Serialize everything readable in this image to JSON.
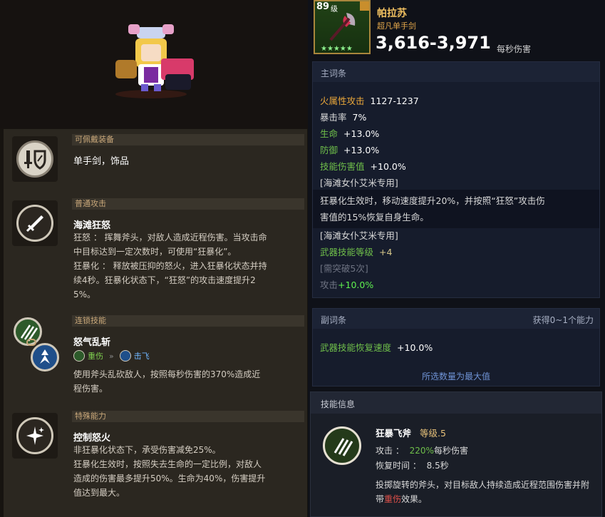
{
  "left": {
    "equip": {
      "category": "可佩戴装备",
      "name": "单手剑，饰品"
    },
    "normal_attack": {
      "category": "普通攻击",
      "name": "海滩狂怒",
      "lines": [
        "狂怒 ： 挥舞斧头，对敌人造成近程伤害。当攻击命",
        "中目标达到一定次数时，可使用“狂暴化”。",
        "狂暴化 ： 释放被压抑的怒火，进入狂暴化状态并持",
        "续4秒。狂暴化状态下，“狂怒”的攻击速度提升2",
        "5%。"
      ]
    },
    "chain": {
      "category": "连锁技能",
      "name": "怒气乱斩",
      "tag1": "重伤",
      "tag_arrows": "»",
      "tag2": "击飞",
      "lines": [
        "使用斧头乱砍敌人，按照每秒伤害的370%造成近",
        "程伤害。"
      ]
    },
    "special": {
      "category": "特殊能力",
      "name": "控制怒火",
      "lines": [
        "非狂暴化状态下，承受伤害减免25%。",
        "狂暴化生效时，按照失去生命的一定比例，对敌人",
        "造成的伤害最多提升50%。生命为40%，伤害提升",
        "值达到最大。"
      ]
    }
  },
  "weapon": {
    "level": "89",
    "level_unit": "级",
    "stars": "★★★★★",
    "name": "帕拉苏",
    "type": "超凡单手剑",
    "dps": "3,616-3,971",
    "dps_unit": "每秒伤害"
  },
  "main_stats": {
    "title": "主词条",
    "fire_label": "火属性攻击",
    "fire_value": "1127-1237",
    "crit_label": "暴击率",
    "crit_value": "7%",
    "hp_label": "生命",
    "hp_value": "+13.0%",
    "def_label": "防御",
    "def_value": "+13.0%",
    "skill_dmg_label": "技能伤害值",
    "skill_dmg_value": "+10.0%",
    "exclusive1": "[海滩女仆艾米专用]",
    "exclusive_desc_1": "狂暴化生效时，移动速度提升20%，并按照“狂怒”攻击伤",
    "exclusive_desc_2": "害值的15%恢复自身生命。",
    "exclusive2": "[海滩女仆艾米专用]",
    "wskill_label": "武器技能等级",
    "wskill_value": "+4",
    "breakthrough": "[需突破5次]",
    "atk_label": "攻击",
    "atk_value": "+10.0%"
  },
  "sub_stats": {
    "title": "副词条",
    "gain": "获得0~1个能力",
    "regen_label": "武器技能恢复速度",
    "regen_value": "+10.0%",
    "max_note": "所选数量为最大值"
  },
  "skill_info": {
    "title": "技能信息",
    "name": "狂暴飞斧",
    "level": "等级.5",
    "atk_label": "攻击 ：",
    "atk_pct": "220%",
    "atk_suffix": "每秒伤害",
    "cd_label": "恢复时间 ：",
    "cd_value": "8.5秒",
    "desc_1": "投掷旋转的斧头，对目标敌人持续造成近程范围伤害并附",
    "desc_2_prefix": "带",
    "desc_2_red": "重伤",
    "desc_2_suffix": "效果。"
  },
  "colors": {
    "gold": "#f0c060",
    "stat_gold": "#e8a63a",
    "green": "#6fbf4a",
    "bright_green": "#5ff04f",
    "skill_red": "#e0504a",
    "category_text": "#c9a87a"
  }
}
